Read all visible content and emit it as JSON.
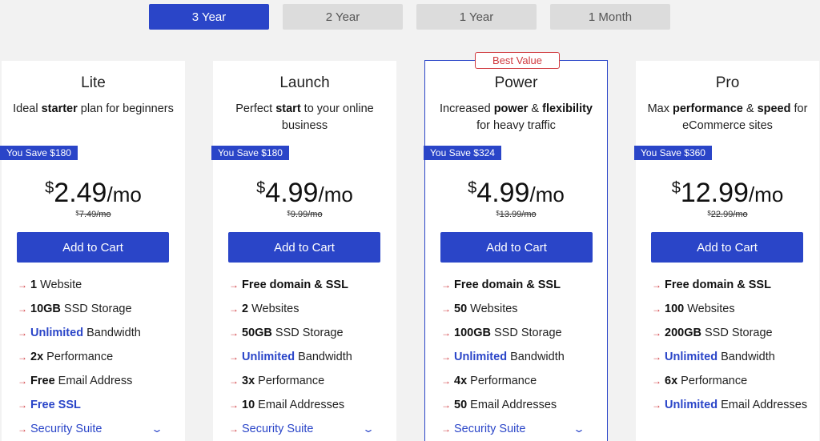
{
  "tabs": [
    {
      "label": "3 Year",
      "active": true
    },
    {
      "label": "2 Year",
      "active": false
    },
    {
      "label": "1 Year",
      "active": false
    },
    {
      "label": "1 Month",
      "active": false
    }
  ],
  "colors": {
    "accent": "#2a45c8",
    "arrow": "#d0393e",
    "badge": "#d0393e"
  },
  "plans": [
    {
      "name": "Lite",
      "desc_parts": [
        "Ideal ",
        "starter",
        " plan for beginners"
      ],
      "save": "You Save $180",
      "currency": "$",
      "price": "2.49",
      "per": "/mo",
      "old_currency": "$",
      "old_price": "7.49/mo",
      "cart": "Add to Cart",
      "features": [
        {
          "bold": "1",
          "rest": " Website"
        },
        {
          "bold": "10GB",
          "rest": " SSD Storage"
        },
        {
          "hl": "Unlimited",
          "rest": " Bandwidth"
        },
        {
          "bold": "2x",
          "rest": " Performance"
        },
        {
          "bold": "Free",
          "rest": " Email Address"
        },
        {
          "hl": "Free SSL",
          "rest": ""
        }
      ],
      "suite": "Security Suite"
    },
    {
      "name": "Launch",
      "desc_parts": [
        "Perfect ",
        "start",
        " to your online business"
      ],
      "save": "You Save $180",
      "currency": "$",
      "price": "4.99",
      "per": "/mo",
      "old_currency": "$",
      "old_price": "9.99/mo",
      "cart": "Add to Cart",
      "features": [
        {
          "bold": "Free domain & SSL",
          "rest": ""
        },
        {
          "bold": "2",
          "rest": " Websites"
        },
        {
          "bold": "50GB",
          "rest": " SSD Storage"
        },
        {
          "hl": "Unlimited",
          "rest": " Bandwidth"
        },
        {
          "bold": "3x",
          "rest": " Performance"
        },
        {
          "bold": "10",
          "rest": " Email Addresses"
        }
      ],
      "suite": "Security Suite"
    },
    {
      "name": "Power",
      "badge": "Best Value",
      "desc_parts": [
        "Increased ",
        "power",
        " & ",
        "flexibility",
        " for heavy traffic"
      ],
      "save": "You Save $324",
      "currency": "$",
      "price": "4.99",
      "per": "/mo",
      "old_currency": "$",
      "old_price": "13.99/mo",
      "cart": "Add to Cart",
      "features": [
        {
          "bold": "Free domain & SSL",
          "rest": ""
        },
        {
          "bold": "50",
          "rest": " Websites"
        },
        {
          "bold": "100GB",
          "rest": " SSD Storage"
        },
        {
          "hl": "Unlimited",
          "rest": " Bandwidth"
        },
        {
          "bold": "4x",
          "rest": " Performance"
        },
        {
          "bold": "50",
          "rest": " Email Addresses"
        }
      ],
      "suite": "Security Suite"
    },
    {
      "name": "Pro",
      "desc_parts": [
        "Max ",
        "performance",
        " & ",
        "speed",
        " for eCommerce sites"
      ],
      "save": "You Save $360",
      "currency": "$",
      "price": "12.99",
      "per": "/mo",
      "old_currency": "$",
      "old_price": "22.99/mo",
      "cart": "Add to Cart",
      "features": [
        {
          "bold": "Free domain & SSL",
          "rest": ""
        },
        {
          "bold": "100",
          "rest": " Websites"
        },
        {
          "bold": "200GB",
          "rest": " SSD Storage"
        },
        {
          "hl": "Unlimited",
          "rest": " Bandwidth"
        },
        {
          "bold": "6x",
          "rest": " Performance"
        },
        {
          "hl": "Unlimited",
          "rest": " Email Addresses"
        }
      ]
    }
  ]
}
